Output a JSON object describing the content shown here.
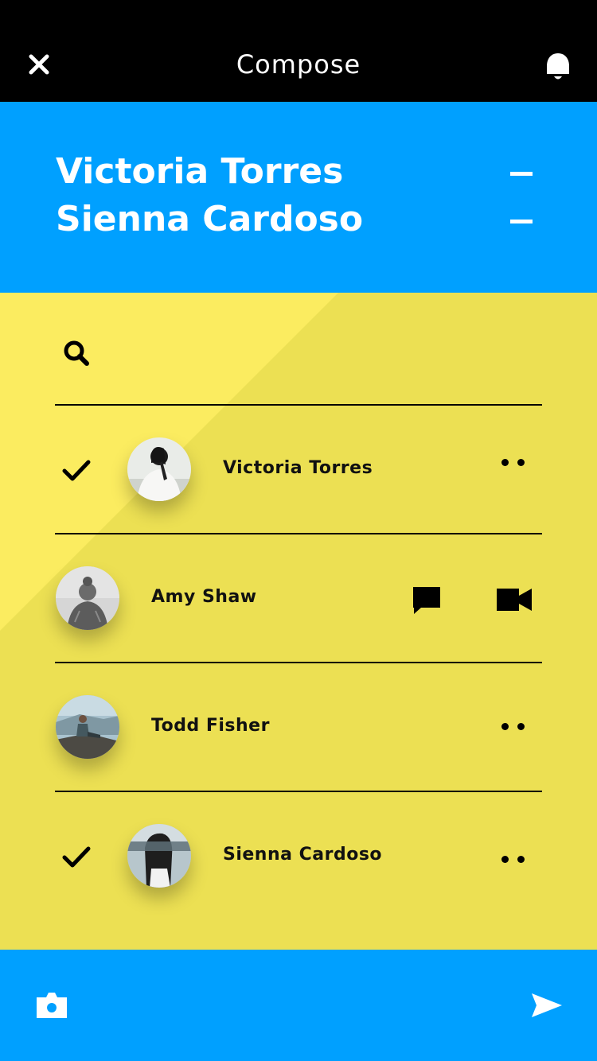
{
  "header": {
    "title": "Compose",
    "close_icon": "close-icon",
    "bell_icon": "bell-icon"
  },
  "recipients": [
    {
      "name": "Victoria Torres"
    },
    {
      "name": "Sienna Cardoso"
    }
  ],
  "search": {
    "icon": "search-icon",
    "value": ""
  },
  "contacts": [
    {
      "name": "Victoria Torres",
      "selected": true,
      "actions": "more"
    },
    {
      "name": "Amy Shaw",
      "selected": false,
      "actions": "message-video"
    },
    {
      "name": "Todd Fisher",
      "selected": false,
      "actions": "more"
    },
    {
      "name": "Sienna Cardoso",
      "selected": true,
      "actions": "more"
    }
  ],
  "footer": {
    "camera_icon": "camera-icon",
    "send_icon": "send-icon"
  },
  "colors": {
    "header_bg": "#000000",
    "accent_blue": "#00a0ff",
    "list_yellow": "#ece053",
    "list_yellow_light": "#fbec60"
  }
}
